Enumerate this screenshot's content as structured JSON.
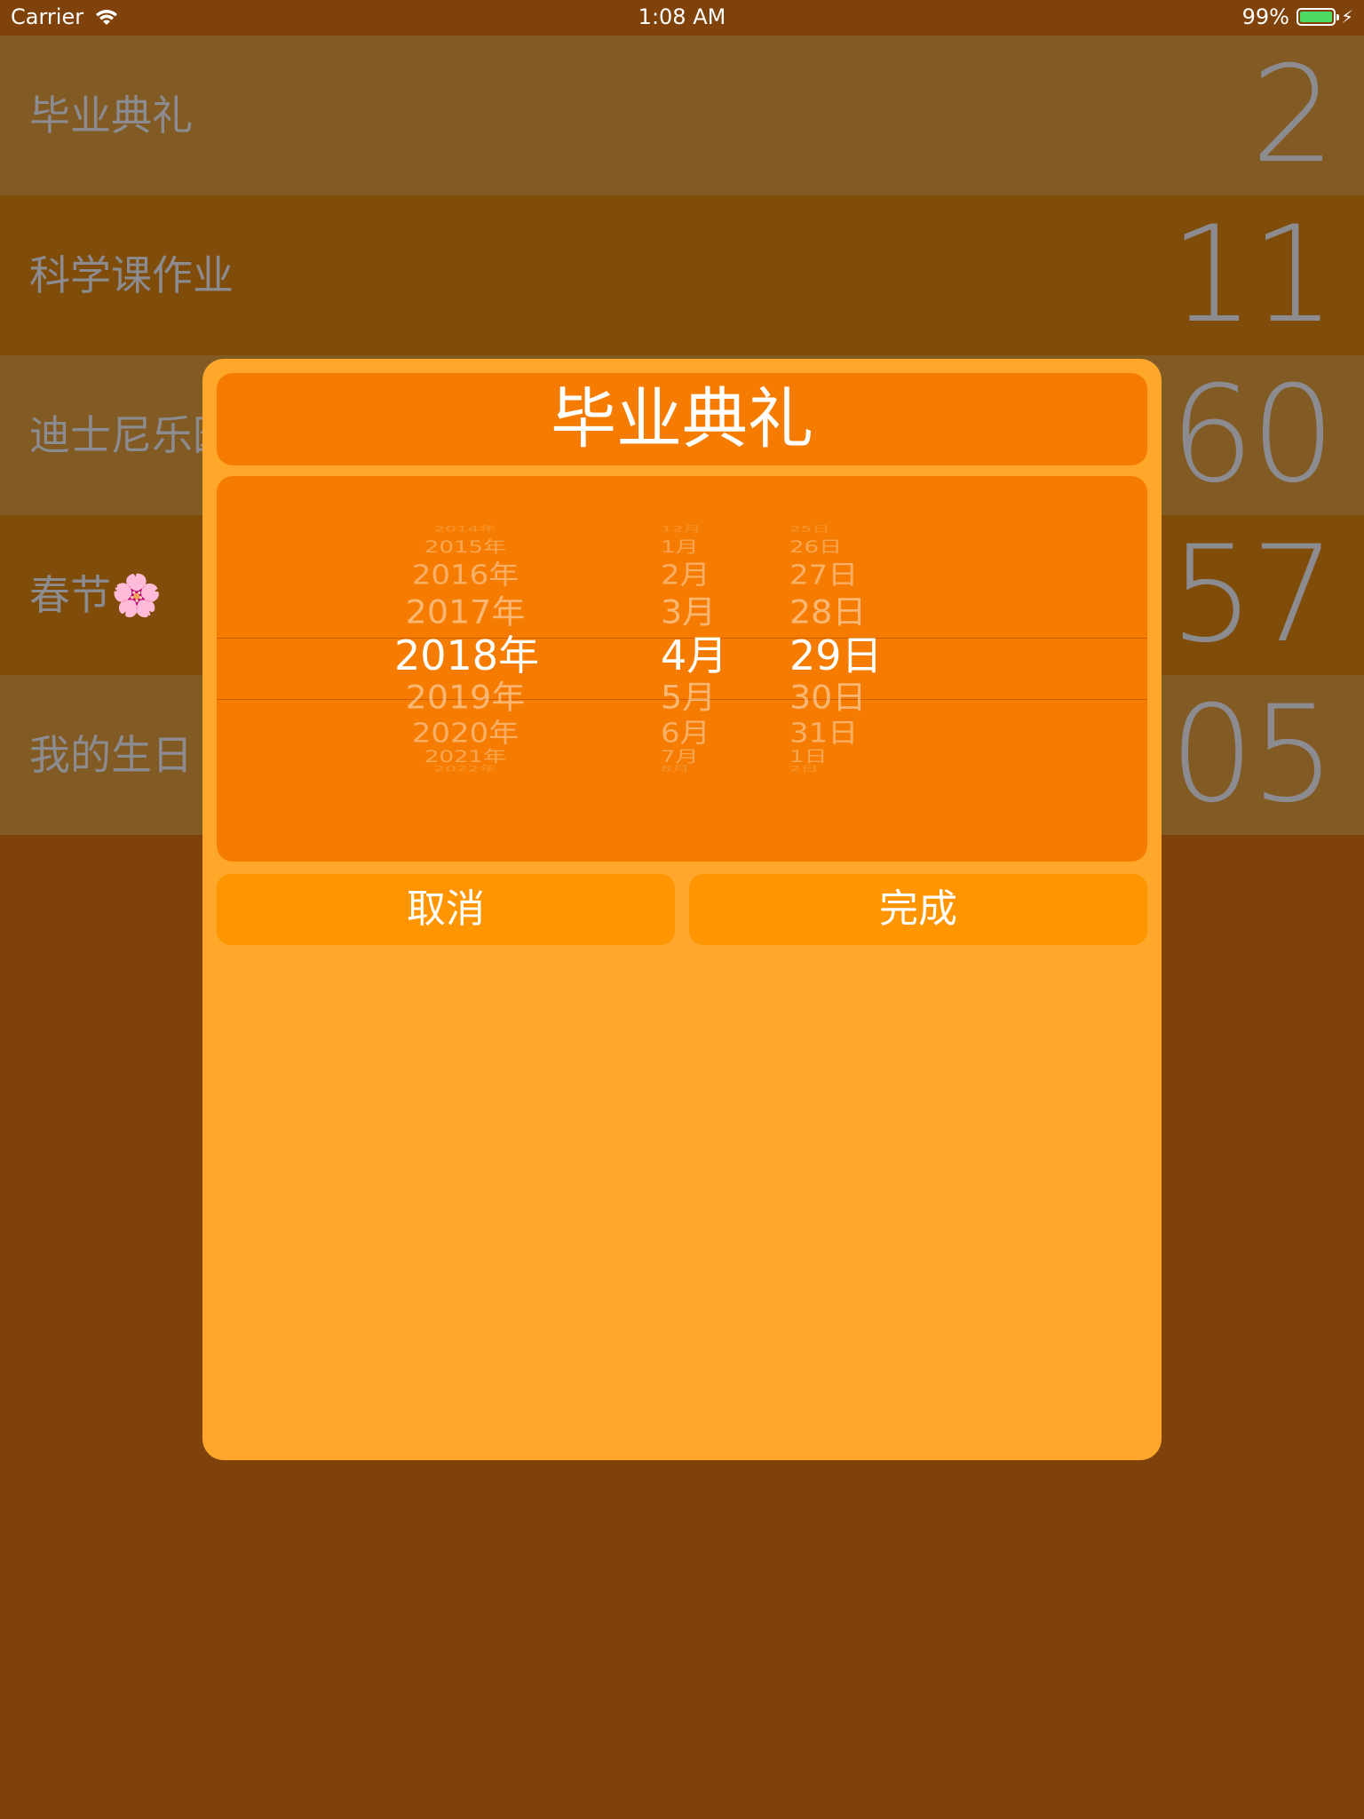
{
  "status_bar": {
    "carrier": "Carrier",
    "time": "1:08 AM",
    "battery": "99%",
    "battery_color": "#4cd964"
  },
  "events": [
    {
      "name": "毕业典礼",
      "count": "2",
      "bg": "#825a23"
    },
    {
      "name": "科学课作业",
      "count": "11",
      "bg": "#7f4c09"
    },
    {
      "name": "迪士尼乐园",
      "count": "60",
      "bg": "#825a23"
    },
    {
      "name": "春节",
      "emoji": "🌸",
      "count": "257",
      "bg": "#7f4c09"
    },
    {
      "name": "我的生日",
      "count": "305",
      "bg": "#825a23"
    }
  ],
  "modal": {
    "title": "毕业典礼",
    "picker": {
      "years": [
        "2014年",
        "2015年",
        "2016年",
        "2017年",
        "2018年",
        "2019年",
        "2020年",
        "2021年",
        "2022年"
      ],
      "months": [
        "12月",
        "1月",
        "2月",
        "3月",
        "4月",
        "5月",
        "6月",
        "7月",
        "8月"
      ],
      "days": [
        "25日",
        "26日",
        "27日",
        "28日",
        "29日",
        "30日",
        "31日",
        "1日",
        "2日"
      ],
      "selected": {
        "year": "2018年",
        "month": "4月",
        "day": "29日"
      }
    },
    "cancel_label": "取消",
    "done_label": "完成"
  },
  "colors": {
    "background": "#7f420a",
    "modal": "#ffa72a",
    "accent": "#f57c00",
    "button": "#ff9500"
  }
}
